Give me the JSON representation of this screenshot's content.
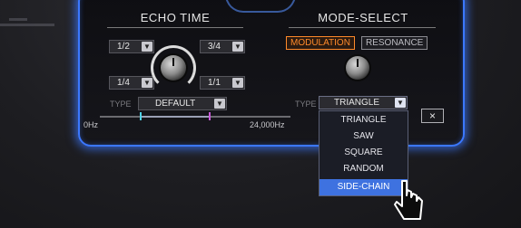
{
  "echo": {
    "title": "ECHO TIME",
    "select_top_left": "1/2",
    "select_top_right": "3/4",
    "select_bottom_left": "1/4",
    "select_bottom_right": "1/1",
    "type_label": "TYPE",
    "type_value": "DEFAULT"
  },
  "frequency": {
    "min_label": "0Hz",
    "max_label": "24,000Hz",
    "marker_colors": [
      "#4fd1e6",
      "#c85ad8"
    ]
  },
  "mode": {
    "title": "MODE-SELECT",
    "buttons": [
      "MODULATION",
      "RESONANCE"
    ],
    "active_button": "MODULATION",
    "type_label": "TYPE",
    "type_value": "TRIANGLE"
  },
  "dropdown": {
    "options": [
      "TRIANGLE",
      "SAW",
      "SQUARE",
      "RANDOM",
      "SIDE-CHAIN"
    ],
    "highlighted": "SIDE-CHAIN"
  },
  "close_label": "×",
  "colors": {
    "accent_glow": "#3b78ff",
    "active_orange": "#ff8a2a",
    "highlight": "#3e72e0"
  },
  "icons": {
    "arrow": "chevron-down-icon",
    "cursor": "pointer-cursor-icon",
    "close": "close-icon"
  }
}
